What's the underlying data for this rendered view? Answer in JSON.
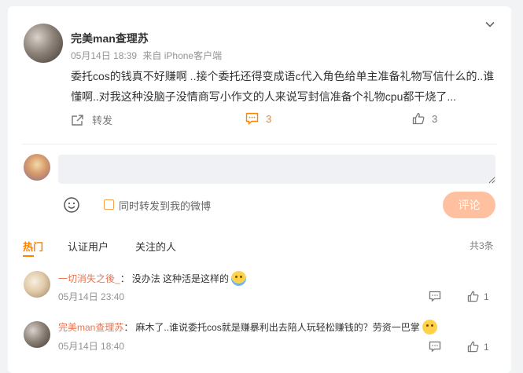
{
  "post": {
    "author": "完美man查理苏",
    "date": "05月14日 18:39",
    "source": "来自 iPhone客户端",
    "content": "委托cos的钱真不好赚啊 ..接个委托还得变成语c代入角色给单主准备礼物写信什么的..谁懂啊..对我这种没脑子没情商写小作文的人来说写封信准备个礼物cpu都干烧了...",
    "forward_label": "转发",
    "comment_count": "3",
    "like_count": "3"
  },
  "composer": {
    "placeholder": "",
    "sync_label": "同时转发到我的微博",
    "submit_label": "评论"
  },
  "comments_section": {
    "tabs": [
      {
        "label": "热门",
        "active": true
      },
      {
        "label": "认证用户",
        "active": false
      },
      {
        "label": "关注的人",
        "active": false
      }
    ],
    "total": "共3条"
  },
  "comments": [
    {
      "name": "一切消失之後_",
      "text": "没办法 这种活是这样的",
      "emoji": "crying-face-emoji",
      "time": "05月14日 23:40",
      "likes": "1"
    },
    {
      "name": "完美man查理苏",
      "text": "麻木了..谁说委托cos就是赚暴利出去陪人玩轻松赚钱的？劳资一巴掌",
      "emoji": "smiling-face-emoji",
      "time": "05月14日 18:40",
      "likes": "1"
    }
  ],
  "colors": {
    "accent": "#ff8200",
    "commenter_name": "#eb7350",
    "submit_bg": "#ffc09f"
  }
}
